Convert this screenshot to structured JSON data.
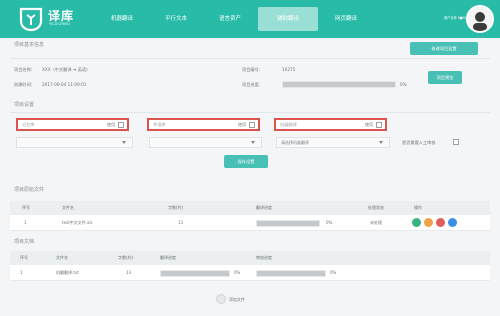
{
  "app": {
    "name": "译库",
    "tagline": "YICAI·ZHIKU"
  },
  "nav": {
    "tabs": [
      {
        "label": "机器翻译",
        "active": false
      },
      {
        "label": "平行文本",
        "active": false
      },
      {
        "label": "语言资产",
        "active": false
      },
      {
        "label": "辅助翻译",
        "active": true
      },
      {
        "label": "网页翻译",
        "active": false
      }
    ],
    "user": {
      "name": "用户名称 13001"
    }
  },
  "project": {
    "section_title": "项目基本信息",
    "name_label": "项目名称：",
    "name_value": "XXX（中文翻译 ➔ 英语）",
    "created_label": "创建时间：",
    "created_value": "2017-06-04 11:09:01",
    "code_label": "项目编号：",
    "code_value": "10275",
    "progress_label": "项目进度：",
    "progress_value": "0%",
    "progress_fraction": 0,
    "edit_button": "修改项目设置",
    "apply_button": "项目预览"
  },
  "settings": {
    "section_title": "项目设置",
    "boxes": [
      {
        "placeholder": "记忆库",
        "action": "使用"
      },
      {
        "placeholder": "术语库",
        "action": "使用"
      },
      {
        "placeholder": "机器翻译",
        "action": "使用"
      }
    ],
    "dropdowns": [
      {
        "value": ""
      },
      {
        "value": ""
      },
      {
        "value": "请选择机器翻译"
      }
    ],
    "checkbox_label": "是否需要人工审核",
    "save_button": "保存设置"
  },
  "tables": [
    {
      "title": "项目原始文件",
      "columns": [
        "序号",
        "文件名",
        "字数(约)",
        "翻译进度",
        "",
        "处理状态",
        "操作"
      ],
      "rows": [
        {
          "index": "1",
          "name": "test中文文件.xls",
          "words": "13",
          "progress_value": "0%",
          "progress_fraction": 0,
          "status": "未处理"
        }
      ]
    },
    {
      "title": "项目文档",
      "columns": [
        "序号",
        "文件名",
        "字数(约)",
        "翻译进度",
        "",
        "审校进度",
        ""
      ],
      "rows": [
        {
          "index": "1",
          "name": "机翻翻译.txt",
          "words": "13",
          "progress_value": "0%",
          "progress_fraction": 0,
          "review_value": "0%",
          "review_fraction": 0
        }
      ]
    }
  ],
  "upload": {
    "label": "添加文件"
  },
  "colors": {
    "header": "#27bba8",
    "accent_button": "#49c0b5",
    "highlight_border": "#d9534f",
    "op_green": "#36b37e",
    "op_orange": "#f0a04b",
    "op_red": "#e25c5c",
    "op_blue": "#3a8ee6"
  }
}
